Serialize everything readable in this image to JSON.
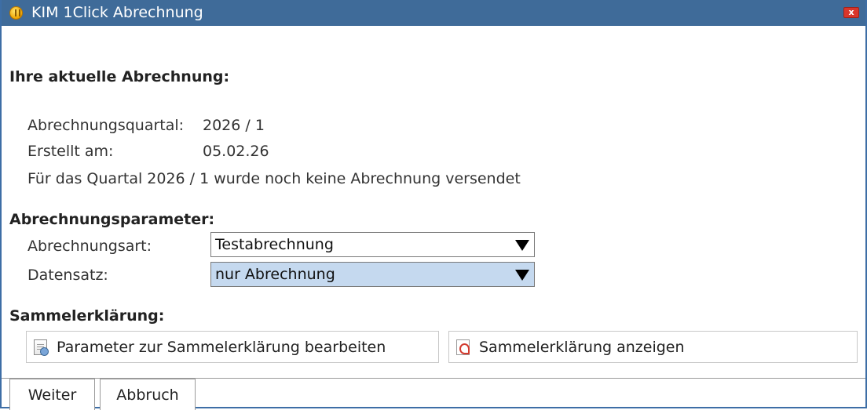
{
  "window": {
    "title": "KIM 1Click Abrechnung",
    "close_label": "x"
  },
  "current": {
    "heading": "Ihre aktuelle Abrechnung:",
    "quarter_label": "Abrechnungsquartal:",
    "quarter_value": "2026 / 1",
    "created_label": "Erstellt am:",
    "created_value": "05.02.26",
    "status_text": "Für das Quartal 2026 / 1 wurde noch keine Abrechnung versendet"
  },
  "params": {
    "heading": "Abrechnungsparameter:",
    "type_label": "Abrechnungsart:",
    "type_value": "Testabrechnung",
    "dataset_label": "Datensatz:",
    "dataset_value": "nur Abrechnung"
  },
  "collective": {
    "heading": "Sammelerklärung:",
    "edit_button": "Parameter zur Sammelerklärung bearbeiten",
    "show_button": "Sammelerklärung anzeigen"
  },
  "footer": {
    "next_button": "Weiter",
    "cancel_button": "Abbruch"
  },
  "icons": {
    "app": "coin-icon",
    "edit": "document-edit-icon",
    "pdf": "pdf-icon"
  },
  "colors": {
    "titlebar": "#3f6b99",
    "highlight": "#c5d9ef",
    "close": "#d9362b"
  }
}
